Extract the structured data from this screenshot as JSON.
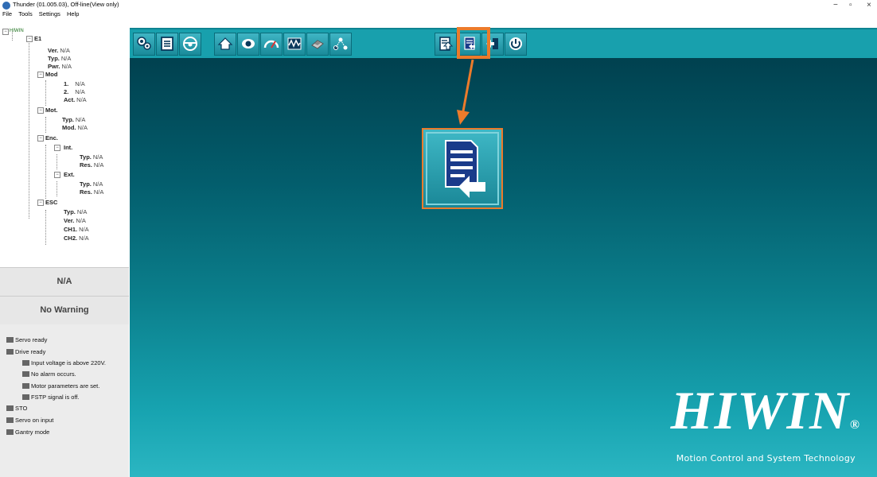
{
  "window": {
    "title": "Thunder (01.005.03), Off-line(View only)",
    "controls": {
      "minimize": "−",
      "restore": "▫",
      "close": "×"
    }
  },
  "menu": [
    "File",
    "Tools",
    "Settings",
    "Help"
  ],
  "tree": {
    "root": "HIWIN",
    "e1": "E1",
    "ver": {
      "label": "Ver.",
      "value": "N/A"
    },
    "typ": {
      "label": "Typ.",
      "value": "N/A"
    },
    "pwr": {
      "label": "Pwr.",
      "value": "N/A"
    },
    "mod": "Mod",
    "mod1": {
      "label": "1.",
      "value": "N/A"
    },
    "mod2": {
      "label": "2.",
      "value": "N/A"
    },
    "modact": {
      "label": "Act.",
      "value": "N/A"
    },
    "mot": "Mot.",
    "mottyp": {
      "label": "Typ.",
      "value": "N/A"
    },
    "motmod": {
      "label": "Mod.",
      "value": "N/A"
    },
    "enc": "Enc.",
    "int": "Int.",
    "inttyp": {
      "label": "Typ.",
      "value": "N/A"
    },
    "intres": {
      "label": "Res.",
      "value": "N/A"
    },
    "ext": "Ext.",
    "exttyp": {
      "label": "Typ.",
      "value": "N/A"
    },
    "extres": {
      "label": "Res.",
      "value": "N/A"
    },
    "esc": "ESC",
    "esctyp": {
      "label": "Typ.",
      "value": "N/A"
    },
    "escver": {
      "label": "Ver.",
      "value": "N/A"
    },
    "escch1": {
      "label": "CH1.",
      "value": "N/A"
    },
    "escch2": {
      "label": "CH2.",
      "value": "N/A"
    }
  },
  "status": {
    "state": "N/A",
    "warning": "No Warning"
  },
  "checks": {
    "servo_ready": "Servo ready",
    "drive_ready": "Drive ready",
    "input_voltage": "Input voltage is above 220V.",
    "no_alarm": "No alarm occurs.",
    "motor_params": "Motor parameters are set.",
    "fstp": "FSTP signal is off.",
    "sto": "STO",
    "servo_on": "Servo on input",
    "gantry": "Gantry mode"
  },
  "toolbar": [
    {
      "icon": "wrench-gear-icon"
    },
    {
      "icon": "document-list-icon"
    },
    {
      "icon": "steering-wheel-icon"
    },
    {
      "icon": "home-icon"
    },
    {
      "icon": "eye-icon"
    },
    {
      "icon": "gauge-icon"
    },
    {
      "icon": "scope-wave-icon"
    },
    {
      "icon": "chip-icon"
    },
    {
      "icon": "nodes-icon"
    },
    {
      "icon": "save-to-drive-icon"
    },
    {
      "icon": "load-from-drive-icon"
    },
    {
      "icon": "import-icon"
    },
    {
      "icon": "reset-icon"
    }
  ],
  "logo": {
    "word": "HIWIN",
    "mark": "®",
    "tagline": "Motion Control and System Technology"
  },
  "colors": {
    "highlight": "#ec7b2b",
    "toolbar": "#18a0ad"
  }
}
